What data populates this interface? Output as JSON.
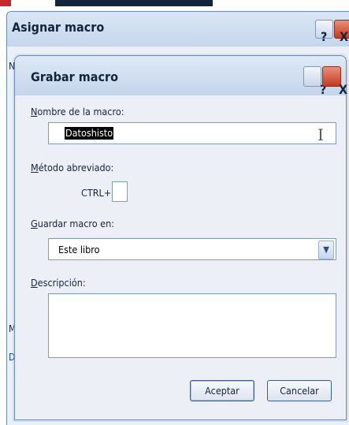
{
  "outer_dialog": {
    "title": "Asignar macro",
    "help_glyph": "?",
    "close_glyph": "X",
    "fragments": [
      "N",
      "M",
      "D"
    ]
  },
  "dialog": {
    "title": "Grabar macro",
    "help_glyph": "?",
    "close_glyph": "X",
    "macro_name": {
      "label_accel": "N",
      "label_rest": "ombre de la macro:",
      "value": "Datoshisto"
    },
    "shortcut": {
      "label_accel": "M",
      "label_rest": "étodo abreviado:",
      "prefix": "CTRL+",
      "value": ""
    },
    "store_in": {
      "label_accel": "G",
      "label_rest": "uardar macro en:",
      "selected": "Este libro",
      "arrow_glyph": "▼"
    },
    "description": {
      "label_accel": "D",
      "label_rest": "escripción:",
      "value": ""
    },
    "ok_label": "Aceptar",
    "cancel_label": "Cancelar"
  },
  "colors": {
    "titlebar": "#c4d5eb",
    "dialog_bg": "#ecf0f6",
    "close_red": "#c23b22"
  }
}
